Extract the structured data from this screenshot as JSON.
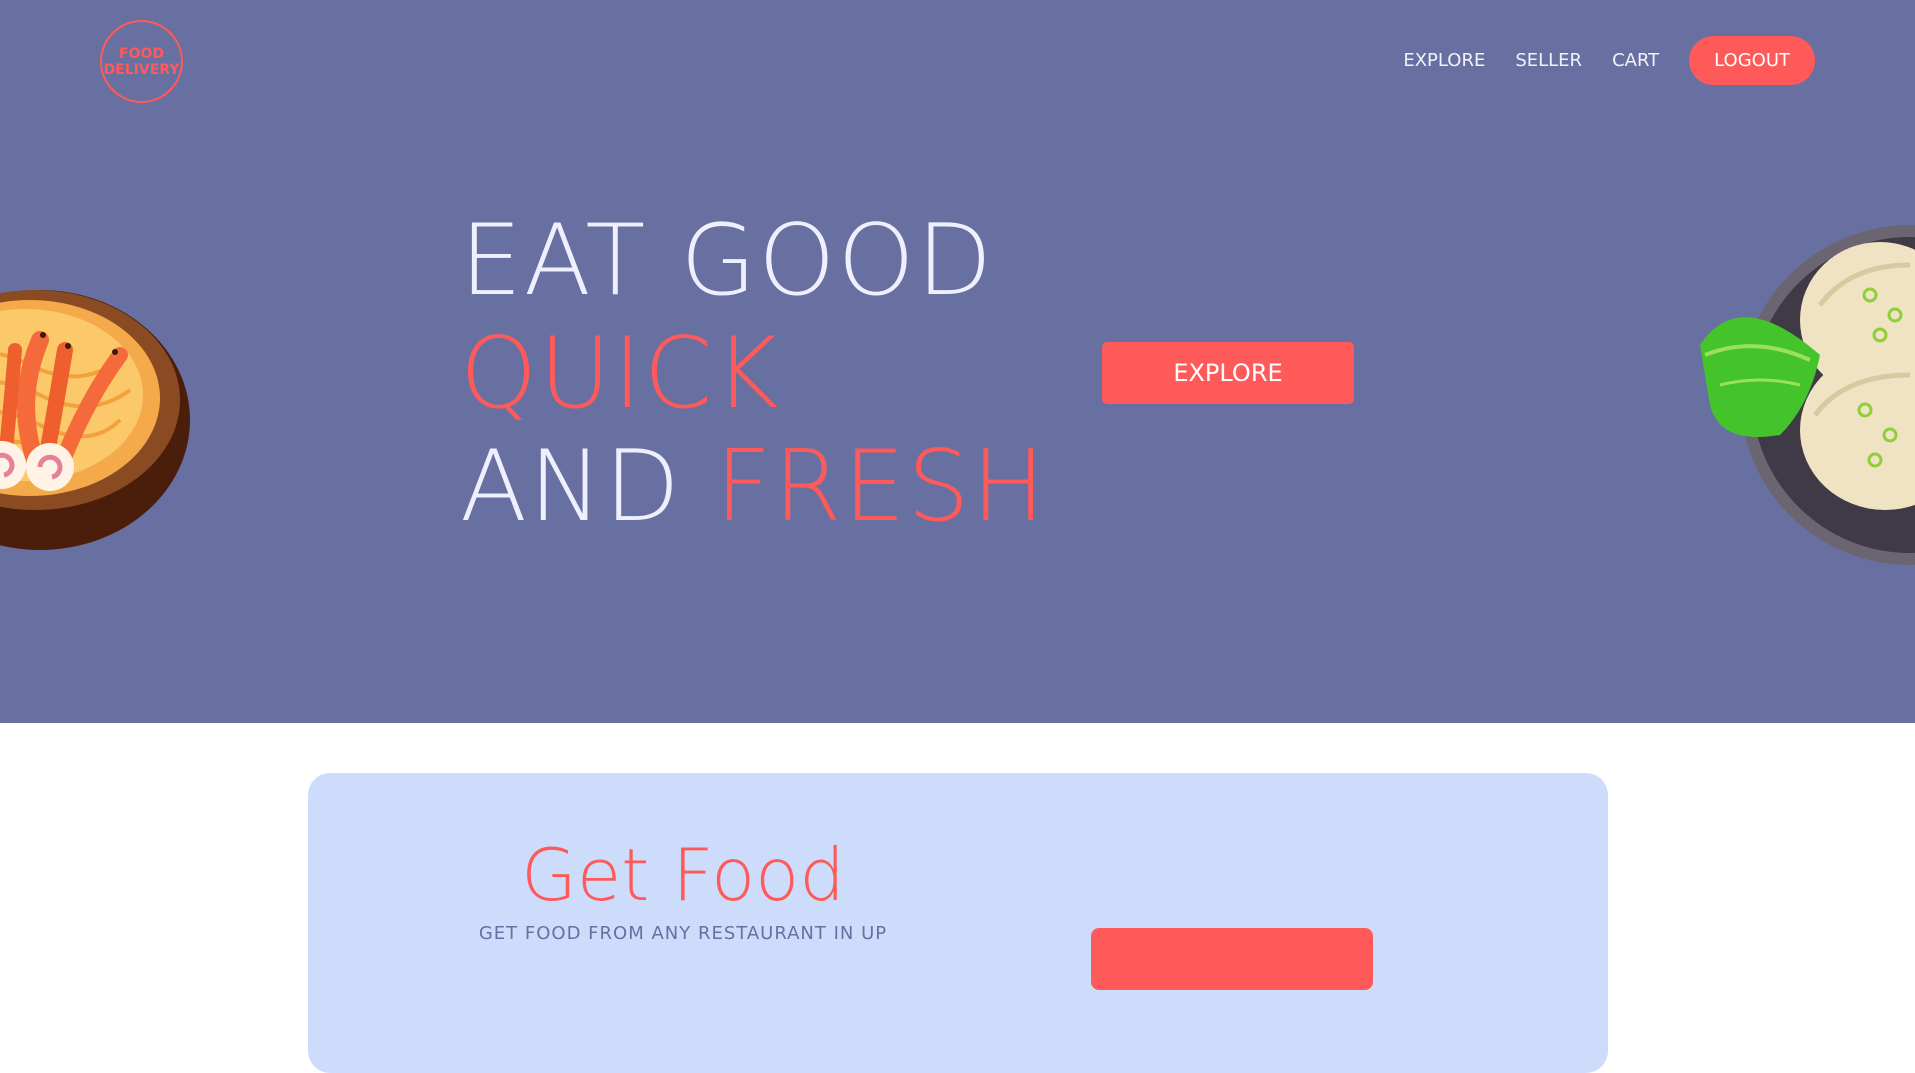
{
  "header": {
    "logo_line1": "FOOD",
    "logo_line2": "DELIVERY",
    "nav": [
      "EXPLORE",
      "SELLER",
      "CART"
    ],
    "logout_label": "LOGOUT"
  },
  "hero": {
    "line1": "EAT GOOD",
    "line2": "QUICK",
    "line3_a": "AND",
    "line3_b": "FRESH",
    "button_label": "EXPLORE"
  },
  "card": {
    "title": "Get Food",
    "subtitle": "GET FOOD FROM ANY RESTAURANT IN UP"
  },
  "colors": {
    "hero_bg": "#6870a2",
    "accent": "#ff5a5a",
    "card_bg": "#cedcfb"
  },
  "icons": {
    "left_illustration": "shrimp-noodle-bowl-icon",
    "right_illustration": "dumplings-plate-icon"
  }
}
